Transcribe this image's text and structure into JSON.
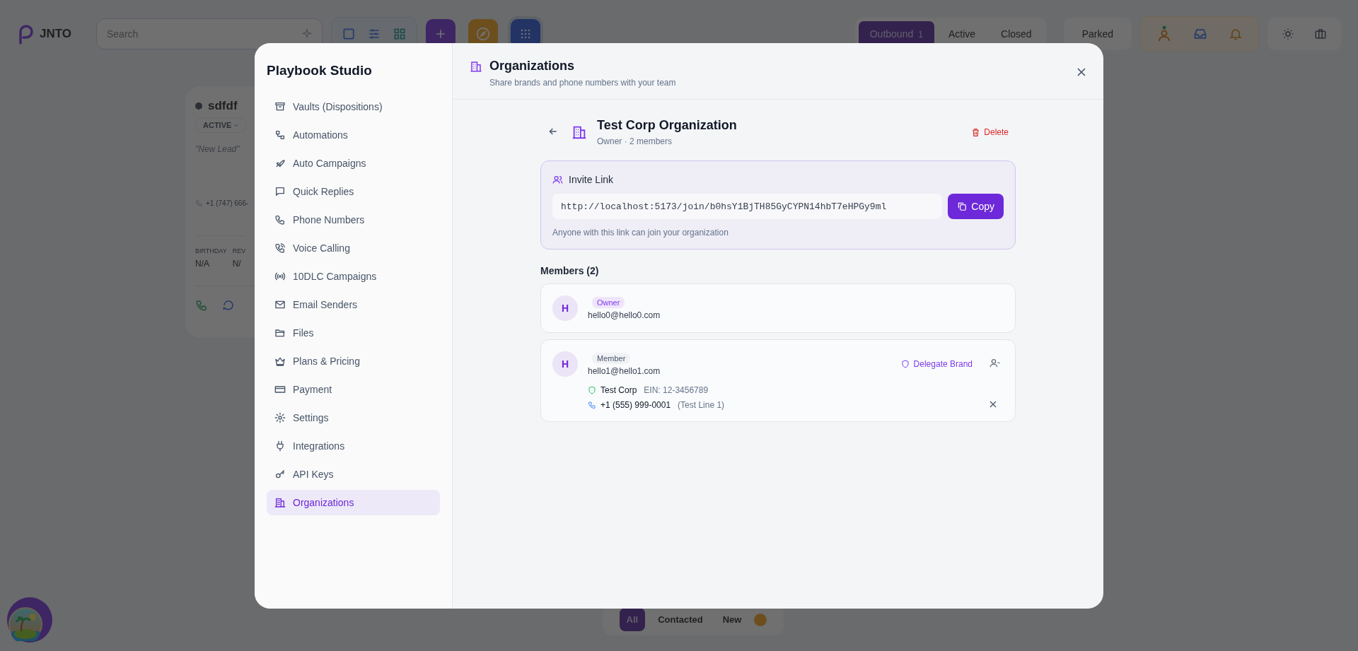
{
  "app": {
    "logo": "JNTO",
    "search": {
      "placeholder": "Search"
    },
    "status_tabs": [
      {
        "label": "Outbound",
        "count": "1",
        "selected": true
      },
      {
        "label": "Active",
        "selected": false
      },
      {
        "label": "Closed",
        "selected": false
      }
    ],
    "parked": "Parked"
  },
  "lead_card": {
    "name": "sdfdf",
    "status": "ACTIVE",
    "note": "\"New Lead\"",
    "phone": "+1 (747) 666-",
    "fields": [
      {
        "label": "BIRTHDAY",
        "value": "N/A"
      },
      {
        "label": "REV",
        "value": "N/"
      }
    ]
  },
  "filter_tabs": [
    {
      "label": "All",
      "selected": true
    },
    {
      "label": "Contacted",
      "selected": false
    },
    {
      "label": "New",
      "selected": false
    }
  ],
  "modal": {
    "title": "Playbook Studio",
    "nav": [
      {
        "label": "Vaults (Dispositions)",
        "selected": false
      },
      {
        "label": "Automations",
        "selected": false
      },
      {
        "label": "Auto Campaigns",
        "selected": false
      },
      {
        "label": "Quick Replies",
        "selected": false
      },
      {
        "label": "Phone Numbers",
        "selected": false
      },
      {
        "label": "Voice Calling",
        "selected": false
      },
      {
        "label": "10DLC Campaigns",
        "selected": false
      },
      {
        "label": "Email Senders",
        "selected": false
      },
      {
        "label": "Files",
        "selected": false
      },
      {
        "label": "Plans & Pricing",
        "selected": false
      },
      {
        "label": "Payment",
        "selected": false
      },
      {
        "label": "Settings",
        "selected": false
      },
      {
        "label": "Integrations",
        "selected": false
      },
      {
        "label": "API Keys",
        "selected": false
      },
      {
        "label": "Organizations",
        "selected": true
      }
    ],
    "header": {
      "title": "Organizations",
      "subtitle": "Share brands and phone numbers with your team"
    },
    "org": {
      "name": "Test Corp Organization",
      "meta": "Owner · 2 members",
      "delete": "Delete"
    },
    "invite": {
      "title": "Invite Link",
      "url": "http://localhost:5173/join/b0hsY1BjTH85GyCYPN14hbT7eHPGy9ml",
      "copy": "Copy",
      "note": "Anyone with this link can join your organization"
    },
    "members_heading": "Members (2)",
    "members": [
      {
        "initial": "H",
        "kind": "owner",
        "role": "Owner",
        "email": "hello0@hello0.com"
      },
      {
        "initial": "H",
        "kind": "member",
        "role": "Member",
        "email": "hello1@hello1.com",
        "delegate": "Delegate Brand",
        "brand": {
          "name": "Test Corp",
          "ein": "EIN: 12-3456789"
        },
        "phone": {
          "number": "+1 (555) 999-0001",
          "label": "(Test Line 1)"
        }
      }
    ]
  }
}
